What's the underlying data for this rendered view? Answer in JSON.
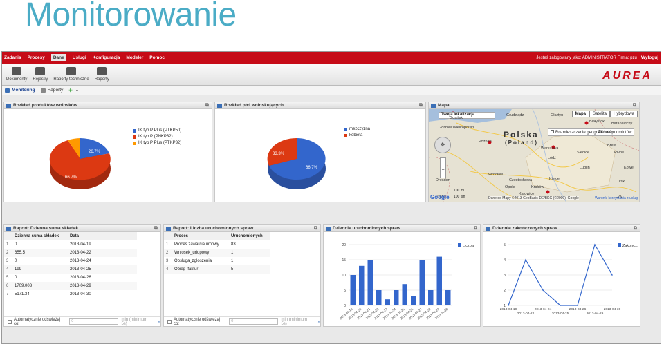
{
  "slide_title": "Monitorowanie",
  "menu": [
    "Zadania",
    "Procesy",
    "Dane",
    "Usługi",
    "Konfiguracja",
    "Modeler",
    "Pomoc"
  ],
  "menu_active": "Dane",
  "user_info": "Jesteś zalogowany jako: ADMINISTRATOR Firma: pzu",
  "logout": "Wyloguj",
  "tools": [
    "Dokumenty",
    "Rejestry",
    "Raporty techniczne",
    "Raporty"
  ],
  "logo": "AUREA",
  "tabs": [
    "Monitoring",
    "Raporty"
  ],
  "tab_more": "...",
  "panels": {
    "p1": "Rozkład produktów wniosków",
    "p2": "Rozkład płci wnioskujących",
    "p3": "Mapa",
    "p4": "Raport: Dzienna suma składek",
    "p5": "Raport: Liczba uruchomionych spraw",
    "p6": "Dziennie uruchomionych spraw",
    "p7": "Dziennie zakończonych spraw"
  },
  "pie1": {
    "legend": [
      "IK typ P Plus (PTKP50)",
      "IK typ P (PNKP32)",
      "IK typ P Plus (PTKP32)"
    ],
    "labels": [
      "26.7%",
      "66.7%"
    ],
    "colors": [
      "#3366cc",
      "#dc3912",
      "#ff9900"
    ]
  },
  "pie2": {
    "legend": [
      "mezczyzna",
      "kobieta"
    ],
    "labels": [
      "33.3%",
      "66.7%"
    ],
    "colors": [
      "#3366cc",
      "#dc3912"
    ]
  },
  "map": {
    "search_label": "Twoja lokalizacja",
    "btn_map": "Mapa",
    "btn_sat": "Satelita",
    "btn_hyb": "Hybrydowa",
    "country": "Polska",
    "country2": "(Poland)",
    "checkbox": "Rozmieszczenie geograficzne podmiotów",
    "credit": "Dane do Mapy ©2013 GeoBasis-DE/BKG (©2009), Google",
    "terms": "Warunki korzystania z usług",
    "scale1": "100 mi",
    "scale2": "100 km",
    "cities": [
      "Gdańsk",
      "Białystok",
      "Poznań",
      "Warszawa",
      "Łódź",
      "Wrocław",
      "Lublin",
      "Kraków",
      "Katowice",
      "Kielce",
      "Częstochowa",
      "Siedlce",
      "Brest",
      "Dresden",
      "Praha",
      "Rivne",
      "Lutsk",
      "Gorzów Wielkopolski",
      "Grudziądz",
      "Olsztyn",
      "Baranavichy",
      "Zabłudów",
      "Lviv",
      "Kowel",
      "Opole"
    ]
  },
  "table1": {
    "headers": [
      "Dzienna suma składek",
      "Data"
    ],
    "rows": [
      [
        "1",
        "0",
        "2013-04-19"
      ],
      [
        "2",
        "655.5",
        "2013-04-22"
      ],
      [
        "3",
        "0",
        "2013-04-24"
      ],
      [
        "4",
        "199",
        "2013-04-25"
      ],
      [
        "5",
        "0",
        "2013-04-26"
      ],
      [
        "6",
        "1709.003",
        "2013-04-29"
      ],
      [
        "7",
        "5171.34",
        "2013-04-30"
      ]
    ]
  },
  "table2": {
    "headers": [
      "Proces",
      "Uruchomionych"
    ],
    "rows": [
      [
        "1",
        "Proces zawarcia umowy",
        "83"
      ],
      [
        "2",
        "Wniosek_urlopowy",
        "1"
      ],
      [
        "3",
        "Obsluga_zgloszenia",
        "1"
      ],
      [
        "4",
        "Obieg_faktur",
        "5"
      ]
    ]
  },
  "footer": {
    "label": "Automatycznie odświeżaj co:",
    "value": "0",
    "hint": "min (minimum 5s)",
    "go": "»"
  },
  "chart_data": [
    {
      "type": "bar",
      "title": "Dziennie uruchomionych spraw",
      "series": [
        {
          "name": "Liczba",
          "values": [
            10,
            13,
            15,
            5,
            2,
            5,
            7,
            3,
            15,
            5,
            16,
            5
          ]
        }
      ],
      "categories": [
        "2013-04-19",
        "2013-04-20",
        "2013-04-21",
        "2013-04-22",
        "2013-04-23",
        "2013-04-24",
        "2013-04-25",
        "2013-04-26",
        "2013-04-27",
        "2013-04-28",
        "2013-04-29",
        "2013-04-30"
      ],
      "ylim": [
        0,
        20
      ],
      "yticks": [
        0,
        5,
        10,
        15,
        20
      ]
    },
    {
      "type": "line",
      "title": "Dziennie zakończonych spraw",
      "series": [
        {
          "name": "Zakonc...",
          "values": [
            1,
            4,
            2,
            1,
            1,
            5,
            3
          ]
        }
      ],
      "categories": [
        "2013-04-19",
        "2013-04-22",
        "2013-04-24",
        "2013-04-25",
        "2013-04-26",
        "2013-04-29",
        "2013-04-30"
      ],
      "xticks": [
        "2013-04-19",
        "2013-04-22",
        "2013-04-24",
        "2013-04-25",
        "2013-04-26",
        "2013-04-29",
        "2013-04-30"
      ],
      "ylim": [
        1,
        5
      ],
      "yticks": [
        1,
        2,
        3,
        4,
        5
      ]
    }
  ]
}
